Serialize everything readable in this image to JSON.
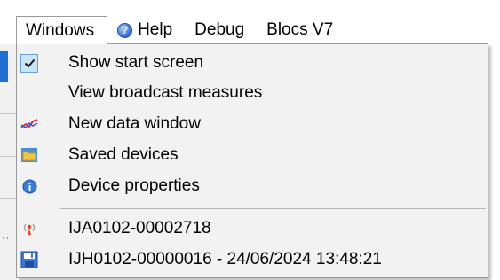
{
  "menubar": {
    "items": [
      {
        "label": "Windows"
      },
      {
        "label": "Help",
        "icon": "help-icon"
      },
      {
        "label": "Debug"
      },
      {
        "label": "Blocs V7"
      }
    ]
  },
  "windows_menu": {
    "items": [
      {
        "label": "Show start screen",
        "icon": "checkmark-icon",
        "checked": true
      },
      {
        "label": "View broadcast measures",
        "icon": null
      },
      {
        "label": "New data window",
        "icon": "line-chart-icon"
      },
      {
        "label": "Saved devices",
        "icon": "folder-icon"
      },
      {
        "label": "Device properties",
        "icon": "info-icon"
      },
      {
        "label": "IJA0102-00002718",
        "icon": "antenna-icon"
      },
      {
        "label": "IJH0102-00000016 - 24/06/2024 13:48:21",
        "icon": "floppy-disk-icon"
      }
    ]
  },
  "colors": {
    "accent_blue": "#1e6fd0",
    "check_highlight": "#cce4f7",
    "menu_background": "#f2f2f2"
  }
}
